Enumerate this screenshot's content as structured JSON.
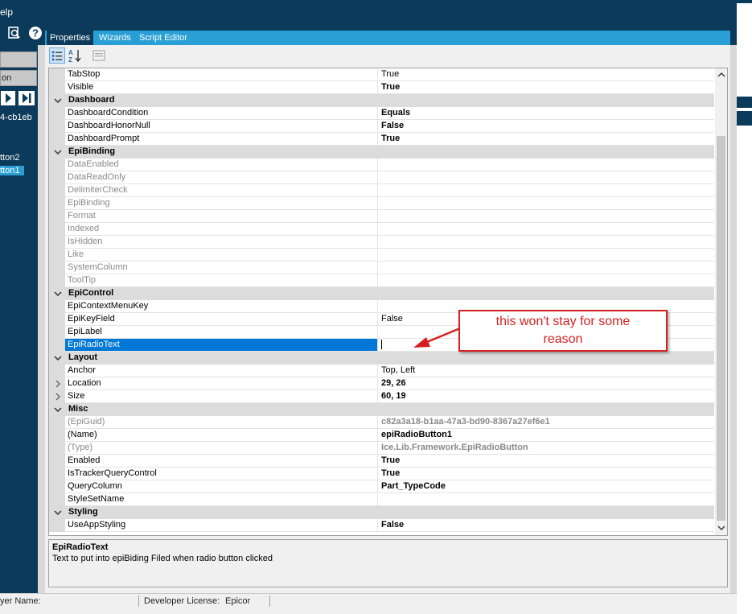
{
  "menu": {
    "help_partial": "elp"
  },
  "left_panel": {
    "box1_label": "",
    "box2_label": "on",
    "guid_partial": "4-cb1eb",
    "tree_item_1": "tton2",
    "tree_item_2": "tton1"
  },
  "tabs": {
    "properties": "Properties",
    "wizards": "Wizards",
    "script_editor": "Script Editor"
  },
  "grid": {
    "rows": [
      {
        "type": "prop",
        "name": "TabStop",
        "value": "True",
        "value_bold": false,
        "gray": false
      },
      {
        "type": "prop",
        "name": "Visible",
        "value": "True",
        "value_bold": true,
        "gray": false
      },
      {
        "type": "cat",
        "name": "Dashboard"
      },
      {
        "type": "prop",
        "name": "DashboardCondition",
        "value": "Equals",
        "value_bold": true,
        "gray": false
      },
      {
        "type": "prop",
        "name": "DashboardHonorNull",
        "value": "False",
        "value_bold": true,
        "gray": false
      },
      {
        "type": "prop",
        "name": "DashboardPrompt",
        "value": "True",
        "value_bold": true,
        "gray": false
      },
      {
        "type": "cat",
        "name": "EpiBinding"
      },
      {
        "type": "prop",
        "name": "DataEnabled",
        "value": "",
        "gray": true
      },
      {
        "type": "prop",
        "name": "DataReadOnly",
        "value": "",
        "gray": true
      },
      {
        "type": "prop",
        "name": "DelimiterCheck",
        "value": "",
        "gray": true
      },
      {
        "type": "prop",
        "name": "EpiBinding",
        "value": "",
        "gray": true
      },
      {
        "type": "prop",
        "name": "Format",
        "value": "",
        "gray": true
      },
      {
        "type": "prop",
        "name": "Indexed",
        "value": "",
        "gray": true
      },
      {
        "type": "prop",
        "name": "IsHidden",
        "value": "",
        "gray": true
      },
      {
        "type": "prop",
        "name": "Like",
        "value": "",
        "gray": true
      },
      {
        "type": "prop",
        "name": "SystemColumn",
        "value": "",
        "gray": true
      },
      {
        "type": "prop",
        "name": "ToolTip",
        "value": "",
        "gray": true
      },
      {
        "type": "cat",
        "name": "EpiControl"
      },
      {
        "type": "prop",
        "name": "EpiContextMenuKey",
        "value": "",
        "gray": false
      },
      {
        "type": "prop",
        "name": "EpiKeyField",
        "value": "False",
        "value_bold": false,
        "gray": false
      },
      {
        "type": "prop",
        "name": "EpiLabel",
        "value": "",
        "gray": false
      },
      {
        "type": "prop",
        "name": "EpiRadioText",
        "value": "",
        "gray": false,
        "selected": true
      },
      {
        "type": "cat",
        "name": "Layout"
      },
      {
        "type": "prop",
        "name": "Anchor",
        "value": "Top, Left",
        "value_bold": false,
        "gray": false
      },
      {
        "type": "prop",
        "name": "Location",
        "value": "29, 26",
        "value_bold": true,
        "gray": false,
        "expand": true
      },
      {
        "type": "prop",
        "name": "Size",
        "value": "60, 19",
        "value_bold": true,
        "gray": false,
        "expand": true
      },
      {
        "type": "cat",
        "name": "Misc"
      },
      {
        "type": "prop",
        "name": "(EpiGuid)",
        "value": "c82a3a18-b1aa-47a3-bd90-8367a27ef6e1",
        "value_bold": true,
        "gray": true
      },
      {
        "type": "prop",
        "name": "(Name)",
        "value": "epiRadioButton1",
        "value_bold": true,
        "gray": false
      },
      {
        "type": "prop",
        "name": "(Type)",
        "value": "Ice.Lib.Framework.EpiRadioButton",
        "value_bold": true,
        "gray": true
      },
      {
        "type": "prop",
        "name": "Enabled",
        "value": "True",
        "value_bold": true,
        "gray": false
      },
      {
        "type": "prop",
        "name": "IsTrackerQueryControl",
        "value": "True",
        "value_bold": true,
        "gray": false
      },
      {
        "type": "prop",
        "name": "QueryColumn",
        "value": "Part_TypeCode",
        "value_bold": true,
        "gray": false
      },
      {
        "type": "prop",
        "name": "StyleSetName",
        "value": "",
        "gray": false
      },
      {
        "type": "cat",
        "name": "Styling"
      },
      {
        "type": "prop",
        "name": "UseAppStyling",
        "value": "False",
        "value_bold": true,
        "gray": false
      }
    ]
  },
  "description": {
    "title": "EpiRadioText",
    "text": "Text to put into epiBiding Filed when radio button clicked"
  },
  "status_bar": {
    "layer_name": "yer Name:",
    "developer_license_label": "Developer License:",
    "developer_license_value": "Epicor"
  },
  "annotation": {
    "line1": "this won't stay for some",
    "line2": "reason",
    "color": "#d62020"
  },
  "colors": {
    "navy": "#0c3a5a",
    "tab_blue": "#2a9fd6",
    "selection": "#0078d7"
  },
  "icons": [
    "zoom-search-icon",
    "help-icon",
    "categorized-icon",
    "alphabetical-sort-icon",
    "property-pages-icon",
    "next-record-icon",
    "last-record-icon"
  ]
}
